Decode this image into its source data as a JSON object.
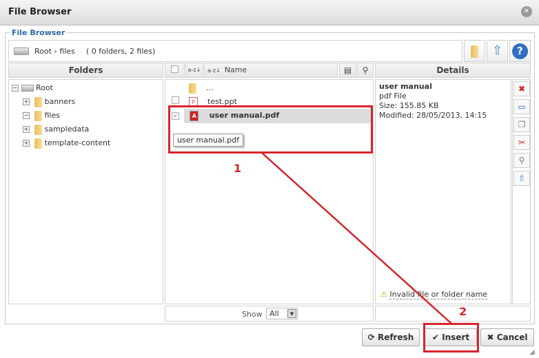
{
  "window": {
    "title": "File Browser"
  },
  "fieldset_label": "File Browser",
  "path": {
    "crumb": "Root › files",
    "summary": "( 0 folders, 2 files)"
  },
  "headers": {
    "folders": "Folders",
    "name": "Name",
    "details": "Details"
  },
  "tree": [
    {
      "label": "Root",
      "toggle": "−"
    },
    {
      "label": "banners",
      "toggle": "+"
    },
    {
      "label": "files",
      "toggle": "−"
    },
    {
      "label": "sampledata",
      "toggle": "+"
    },
    {
      "label": "template-content",
      "toggle": "+"
    }
  ],
  "files": [
    {
      "name": "...",
      "checked": false
    },
    {
      "name": "test.ppt",
      "checked": false
    },
    {
      "name": "user manual.pdf",
      "checked": true,
      "selected": true
    }
  ],
  "tooltip": "user manual.pdf",
  "details": {
    "name": "user manual",
    "type": "pdf File",
    "size": "Size: 155.85 KB",
    "modified": "Modified: 28/05/2013, 14:15",
    "warning": "Invalid file or folder name"
  },
  "footer": {
    "show_label": "Show",
    "show_value": "All"
  },
  "buttons": {
    "refresh": "Refresh",
    "insert": "Insert",
    "cancel": "Cancel"
  },
  "annotations": {
    "one": "1",
    "two": "2",
    "color": "#d8242c"
  }
}
